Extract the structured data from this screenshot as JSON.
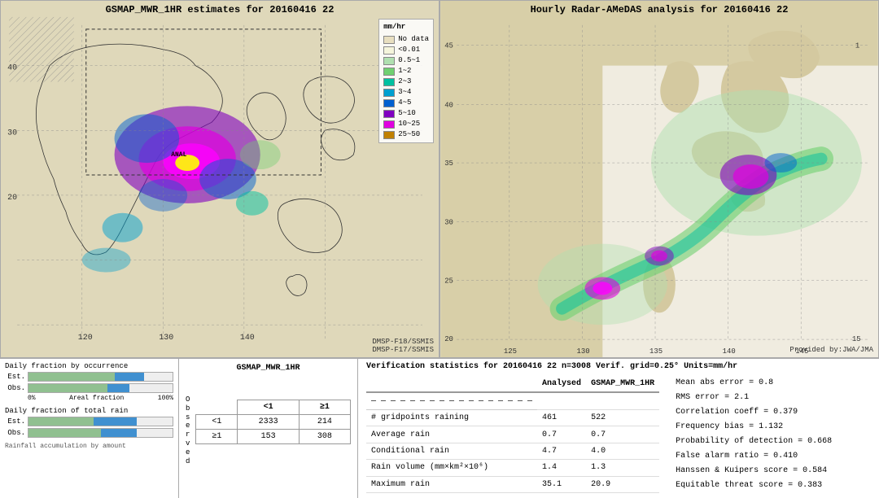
{
  "left_map": {
    "title": "GSMAP_MWR_1HR estimates for 20160416 22",
    "label_top_left": "GSMAP_MWR_1HR",
    "label_bottom": "DMSP-F18/SSMIS",
    "label_bottom2": "DMSP-F17/SSMIS",
    "lat_labels": [
      "40",
      "30",
      "20"
    ],
    "lon_labels": [
      "120",
      "130",
      "140"
    ]
  },
  "right_map": {
    "title": "Hourly Radar-AMeDAS analysis for 20160416 22",
    "credit": "Provided by:JWA/JMA",
    "lat_labels": [
      "45",
      "40",
      "35",
      "30",
      "25",
      "20"
    ],
    "lon_labels": [
      "125",
      "130",
      "135",
      "140",
      "145"
    ]
  },
  "legend": {
    "title": "mm/hr",
    "items": [
      {
        "label": "No data",
        "color": "#e8dfc0"
      },
      {
        "label": "<0.01",
        "color": "#f5f5dc"
      },
      {
        "label": "0.5~1",
        "color": "#b0e0b0"
      },
      {
        "label": "1~2",
        "color": "#70d070"
      },
      {
        "label": "2~3",
        "color": "#00c0a0"
      },
      {
        "label": "3~4",
        "color": "#00a0d0"
      },
      {
        "label": "4~5",
        "color": "#0060d0"
      },
      {
        "label": "5~10",
        "color": "#8000c0"
      },
      {
        "label": "10~25",
        "color": "#e000e0"
      },
      {
        "label": "25~50",
        "color": "#c08000"
      }
    ]
  },
  "charts": {
    "occurrence_title": "Daily fraction by occurrence",
    "total_rain_title": "Daily fraction of total rain",
    "accumulation_label": "Rainfall accumulation by amount",
    "axis_start": "0%",
    "axis_end": "100%",
    "axis_label": "Areal fraction",
    "est_label": "Est.",
    "obs_label": "Obs.",
    "est_bar1_green": 60,
    "est_bar1_blue": 20,
    "obs_bar1_green": 55,
    "obs_bar1_blue": 15,
    "est_bar2_green": 45,
    "est_bar2_blue": 30,
    "obs_bar2_green": 50,
    "obs_bar2_blue": 25
  },
  "contingency": {
    "title": "GSMAP_MWR_1HR",
    "header_lt1": "<1",
    "header_ge1": "≥1",
    "observed_label": "O\nb\ns\ne\nr\nv\ne\nd",
    "row_lt1": "<1",
    "row_ge1": "≥1",
    "cell_lt1_lt1": "2333",
    "cell_lt1_ge1": "214",
    "cell_ge1_lt1": "153",
    "cell_ge1_ge1": "308"
  },
  "verification": {
    "title": "Verification statistics for 20160416 22  n=3008  Verif. grid=0.25°  Units=mm/hr",
    "col_analysed": "Analysed",
    "col_gsmap": "GSMAP_MWR_1HR",
    "rows": [
      {
        "label": "# gridpoints raining",
        "analysed": "461",
        "gsmap": "522"
      },
      {
        "label": "Average rain",
        "analysed": "0.7",
        "gsmap": "0.7"
      },
      {
        "label": "Conditional rain",
        "analysed": "4.7",
        "gsmap": "4.0"
      },
      {
        "label": "Rain volume (mm×km²×10⁶)",
        "analysed": "1.4",
        "gsmap": "1.3"
      },
      {
        "label": "Maximum rain",
        "analysed": "35.1",
        "gsmap": "20.9"
      }
    ],
    "stats_right": [
      "Mean abs error = 0.8",
      "RMS error = 2.1",
      "Correlation coeff = 0.379",
      "Frequency bias = 1.132",
      "Probability of detection = 0.668",
      "False alarm ratio = 0.410",
      "Hanssen & Kuipers score = 0.584",
      "Equitable threat score = 0.383"
    ]
  }
}
